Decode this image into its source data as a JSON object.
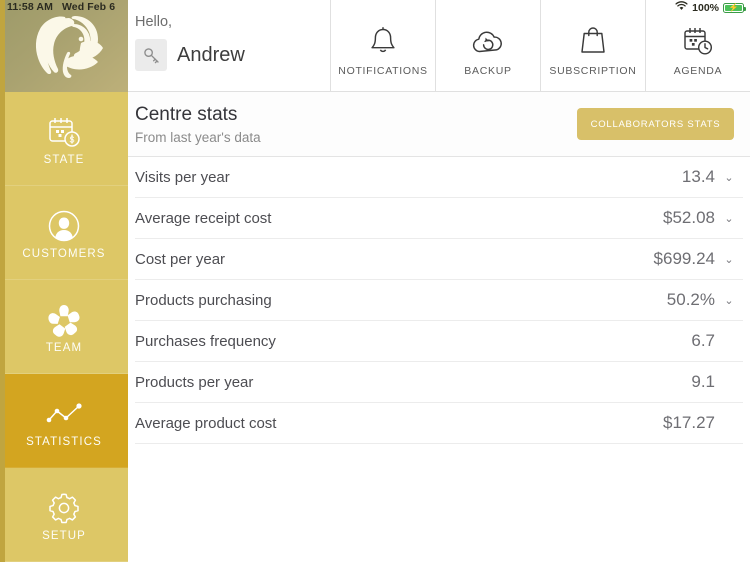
{
  "status_bar": {
    "time": "11:58 AM",
    "date": "Wed Feb 6",
    "wifi_icon": "wifi-icon",
    "battery_percent": "100%",
    "battery_icon": "battery-charging-icon",
    "battery_color": "#4cc259"
  },
  "sidebar": {
    "logo_icon": "salon-woman-leaf-logo",
    "background_color": "#ddc766",
    "active_color": "#d3a520",
    "items": [
      {
        "label": "STATE",
        "icon": "calendar-dollar-icon",
        "active": false
      },
      {
        "label": "CUSTOMERS",
        "icon": "person-circle-icon",
        "active": false
      },
      {
        "label": "TEAM",
        "icon": "flower-icon",
        "active": false
      },
      {
        "label": "STATISTICS",
        "icon": "line-chart-icon",
        "active": true
      },
      {
        "label": "SETUP",
        "icon": "gear-icon",
        "active": false
      }
    ]
  },
  "topbar": {
    "greeting": "Hello,",
    "user_name": "Andrew",
    "user_icon": "key-icon",
    "nav_items": [
      {
        "label": "NOTIFICATIONS",
        "icon": "bell-icon"
      },
      {
        "label": "BACKUP",
        "icon": "cloud-refresh-icon"
      },
      {
        "label": "SUBSCRIPTION",
        "icon": "shopping-bag-icon"
      },
      {
        "label": "AGENDA",
        "icon": "calendar-clock-icon"
      }
    ]
  },
  "page_header": {
    "title": "Centre stats",
    "subtitle": "From last year's data",
    "action_button": "COLLABORATORS STATS",
    "action_button_color": "#d8c069"
  },
  "stats": {
    "chevron_icon": "chevron-down-icon",
    "rows": [
      {
        "label": "Visits per year",
        "value": "13.4",
        "expandable": true
      },
      {
        "label": "Average receipt cost",
        "value": "$52.08",
        "expandable": true
      },
      {
        "label": "Cost per year",
        "value": "$699.24",
        "expandable": true
      },
      {
        "label": "Products purchasing",
        "value": "50.2%",
        "expandable": true
      },
      {
        "label": "Purchases frequency",
        "value": "6.7",
        "expandable": false
      },
      {
        "label": "Products per year",
        "value": "9.1",
        "expandable": false
      },
      {
        "label": "Average product cost",
        "value": "$17.27",
        "expandable": false
      }
    ]
  }
}
